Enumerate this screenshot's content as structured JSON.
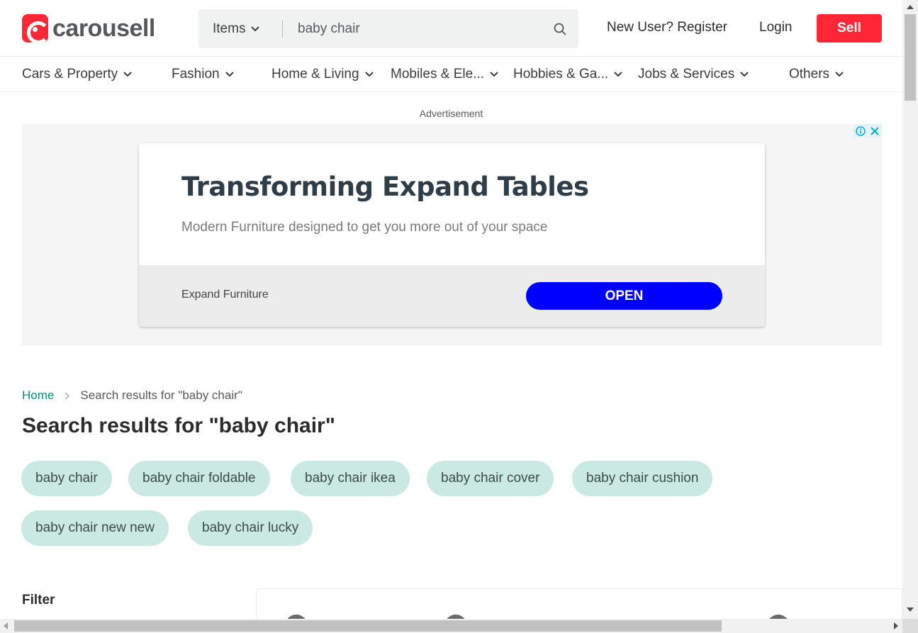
{
  "header": {
    "logo_text": "carousell",
    "search_category": "Items",
    "search_value": "baby chair",
    "register_label": "New User? Register",
    "login_label": "Login",
    "sell_label": "Sell"
  },
  "categories": [
    {
      "label": "Cars & Property"
    },
    {
      "label": "Fashion"
    },
    {
      "label": "Home & Living"
    },
    {
      "label": "Mobiles & Ele..."
    },
    {
      "label": "Hobbies & Ga..."
    },
    {
      "label": "Jobs & Services"
    },
    {
      "label": "Others"
    }
  ],
  "ad": {
    "label": "Advertisement",
    "title": "Transforming Expand Tables",
    "description": "Modern Furniture designed to get you more out of your space",
    "brand": "Expand Furniture",
    "cta": "OPEN"
  },
  "breadcrumb": {
    "home": "Home",
    "current": "Search results for \"baby chair\""
  },
  "page_title": "Search results for \"baby chair\"",
  "suggestions": [
    "baby chair",
    "baby chair foldable",
    "baby chair ikea",
    "baby chair cover",
    "baby chair cushion",
    "baby chair new new",
    "baby chair lucky"
  ],
  "filter_label": "Filter",
  "colors": {
    "brand_red": "#ff2636",
    "chip_bg": "#cbe9e3",
    "link_green": "#008f79",
    "ad_cta_blue": "#0000ff"
  }
}
